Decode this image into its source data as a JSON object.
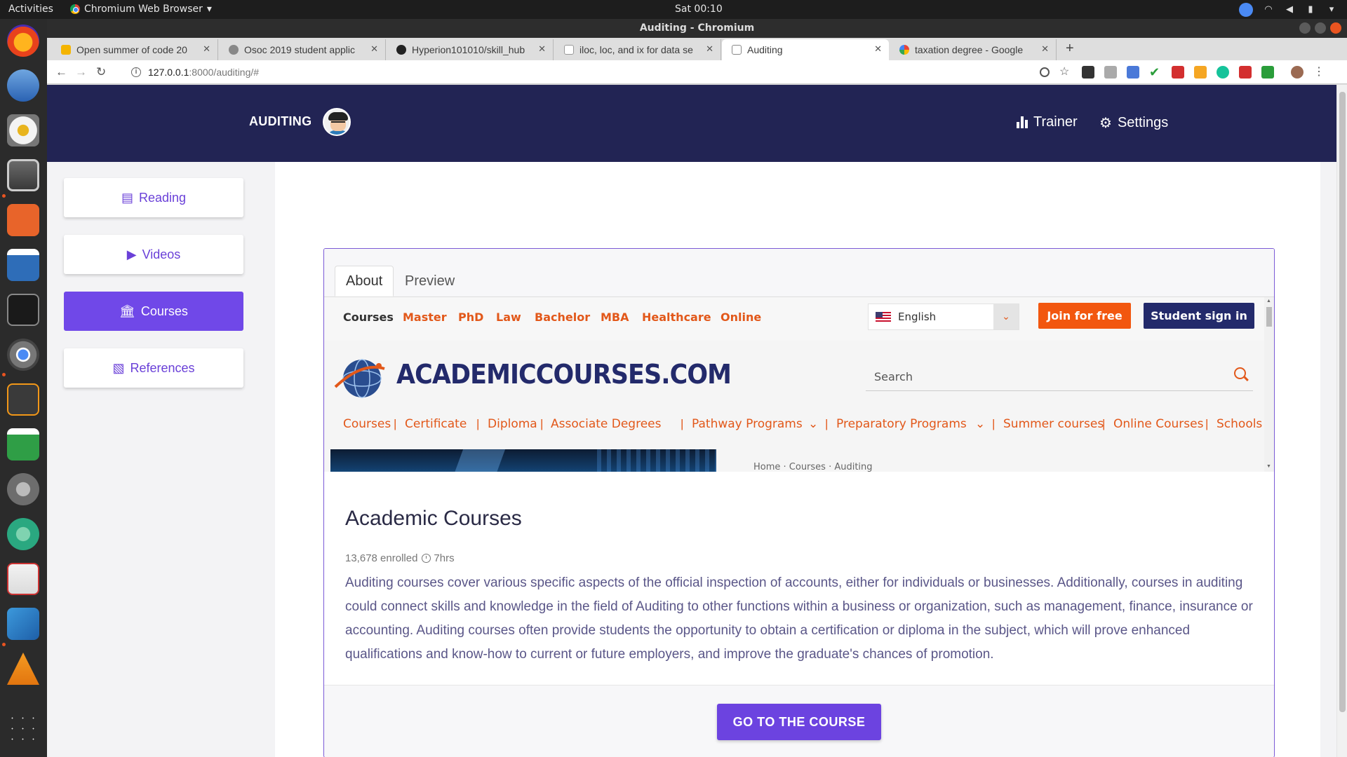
{
  "os": {
    "activities": "Activities",
    "app_name": "Chromium Web Browser",
    "clock": "Sat 00:10"
  },
  "window": {
    "title": "Auditing - Chromium"
  },
  "tabs": [
    {
      "label": "Open summer of code 20",
      "favicon_color": "#f4b400"
    },
    {
      "label": "Osoc 2019 student applic",
      "favicon_color": "#888888"
    },
    {
      "label": "Hyperion101010/skill_hub",
      "favicon_color": "#222222"
    },
    {
      "label": "iloc, loc, and ix for data se",
      "favicon_color": "#bbbbbb"
    },
    {
      "label": "Auditing",
      "favicon_color": "#999999"
    },
    {
      "label": "taxation degree - Google",
      "favicon_color": "#4285f4"
    }
  ],
  "address": {
    "host": "127.0.0.1",
    "rest": ":8000/auditing/#"
  },
  "app": {
    "brand": "AUDITING",
    "nav": {
      "trainer": "Trainer",
      "settings": "Settings"
    },
    "sidebar": [
      {
        "label": "Reading",
        "icon": "book-icon"
      },
      {
        "label": "Videos",
        "icon": "play-icon"
      },
      {
        "label": "Courses",
        "icon": "institution-icon",
        "active": true
      },
      {
        "label": "References",
        "icon": "file-icon"
      }
    ],
    "accent": "#7048e8",
    "nav_bg": "#222454"
  },
  "course": {
    "tabs": [
      "About",
      "Preview"
    ],
    "title": "Academic Courses",
    "enrolled": "13,678 enrolled",
    "duration": "7hrs",
    "description": "Auditing courses cover various specific aspects of the official inspection of accounts, either for individuals or businesses. Additionally, courses in auditing could connect skills and knowledge in the field of Auditing to other functions within a business or organization, such as management, finance, insurance or accounting. Auditing courses often provide students the opportunity to obtain a certification or diploma in the subject, which will prove enhanced qualifications and know-how to current or future employers, and improve the graduate's chances of promotion.",
    "cta": "GO TO THE COURSE"
  },
  "embedded": {
    "top_links": [
      "Courses",
      "Master",
      "PhD",
      "Law",
      "Bachelor",
      "MBA",
      "Healthcare",
      "Online"
    ],
    "language": "English",
    "join": "Join for free",
    "signin": "Student sign in",
    "logo": "ACADEMICCOURSES.COM",
    "search_placeholder": "Search",
    "sub_links": [
      "Courses",
      "Certificate",
      "Diploma",
      "Associate Degrees",
      "Pathway Programs",
      "Preparatory Programs",
      "Summer courses",
      "Online Courses",
      "Schools by C"
    ],
    "breadcrumb": "Home · Courses · Auditing",
    "brand_orange": "#e2581a",
    "brand_navy": "#232a6b"
  }
}
